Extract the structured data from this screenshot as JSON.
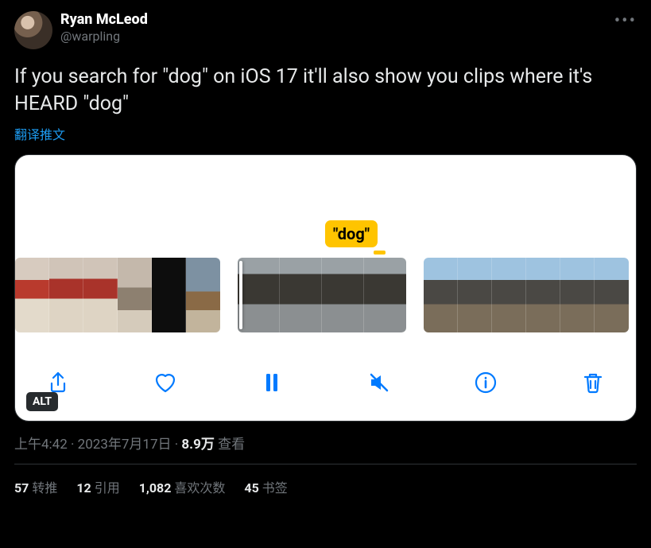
{
  "author": {
    "display_name": "Ryan McLeod",
    "handle": "@warpling"
  },
  "tweet_text": "If you search for \"dog\" on iOS 17 it'll also show you clips where it's HEARD \"dog\"",
  "translate_label": "翻译推文",
  "media": {
    "caption_badge": "\"dog\"",
    "alt_badge": "ALT",
    "toolbar_icons": [
      "share",
      "heart",
      "pause",
      "mute",
      "info",
      "trash"
    ]
  },
  "meta": {
    "time": "上午4:42",
    "date": "2023年7月17日",
    "views_count": "8.9万",
    "views_label": "查看",
    "separator": " · "
  },
  "stats": {
    "retweets": {
      "count": "57",
      "label": "转推"
    },
    "quotes": {
      "count": "12",
      "label": "引用"
    },
    "likes": {
      "count": "1,082",
      "label": "喜欢次数"
    },
    "bookmarks": {
      "count": "45",
      "label": "书签"
    }
  }
}
